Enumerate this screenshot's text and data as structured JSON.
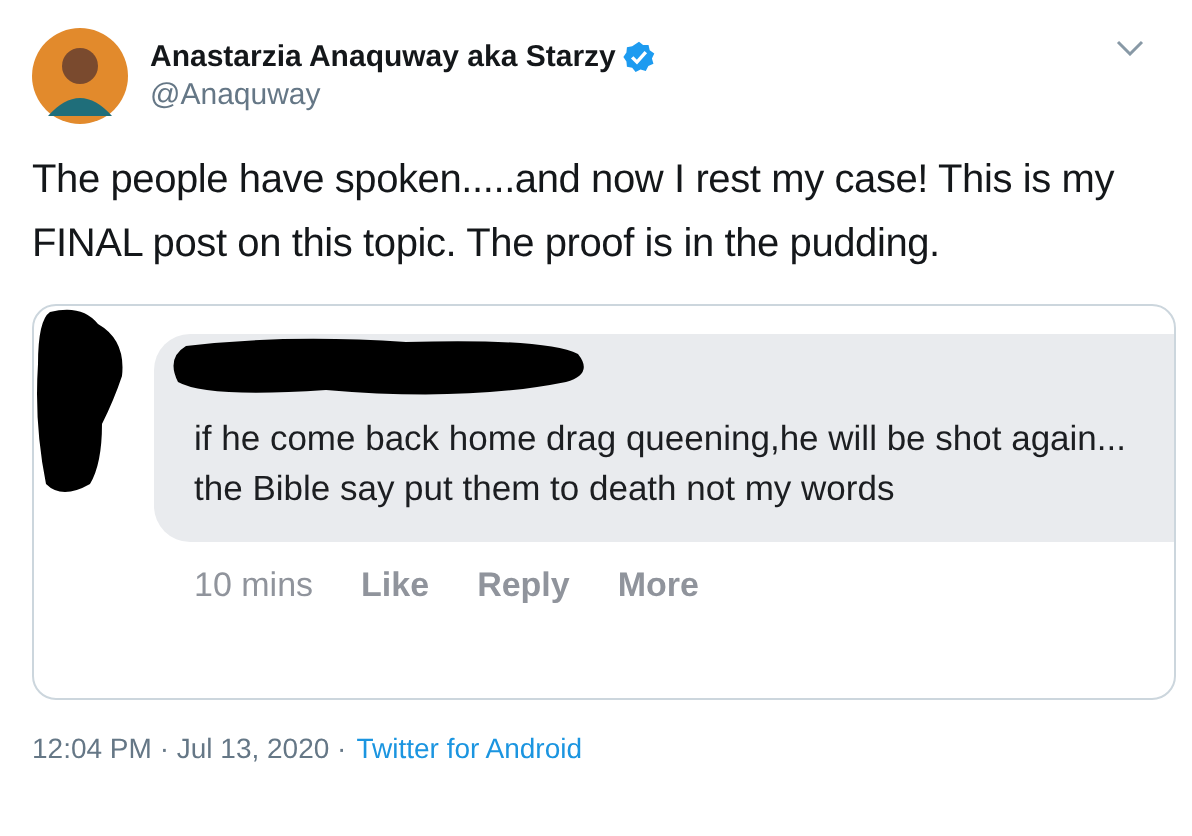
{
  "author": {
    "name": "Anastarzia Anaquway aka Starzy",
    "handle": "@Anaquway",
    "verified": true
  },
  "text": "The people have spoken.....and now I rest my case! This is my FINAL post on this topic. The proof is in the pudding.",
  "embedded_comment": {
    "text": "if he come back home drag queening,he will be shot again... the Bible say put them to death not my words",
    "meta": [
      {
        "kind": "time",
        "label": "10 mins"
      },
      {
        "kind": "action",
        "label": "Like"
      },
      {
        "kind": "action",
        "label": "Reply"
      },
      {
        "kind": "action",
        "label": "More"
      }
    ]
  },
  "footer": {
    "timestamp": "12:04 PM · Jul 13, 2020 ·",
    "source": "Twitter for Android"
  }
}
